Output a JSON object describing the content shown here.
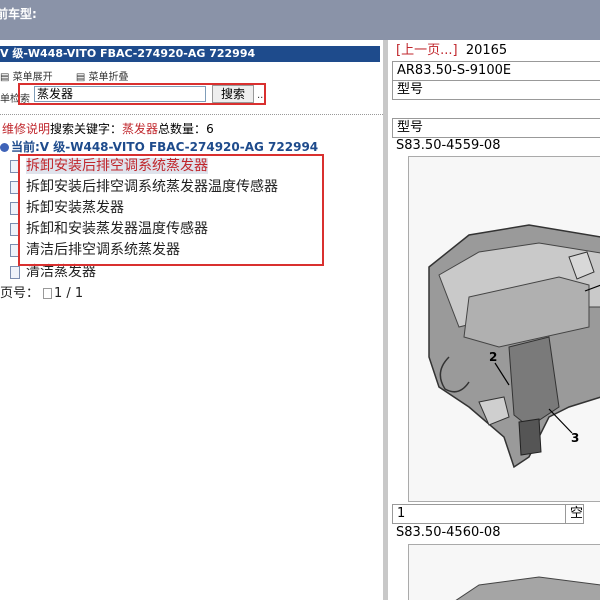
{
  "topbar": {
    "title": "前车型:"
  },
  "left": {
    "header": "V 级-W448-VITO FBAC-274920-AG 722994",
    "menu": {
      "expand": "菜单展开",
      "collapse": "菜单折叠"
    },
    "search": {
      "label": "单检索",
      "value": "蒸发器",
      "button": "搜索",
      "dots": "..."
    },
    "keyword": {
      "prefix": "维修说明",
      "mid": "搜索关键字：",
      "term": "蒸发器",
      "count_label": "总数量：",
      "count": "6"
    },
    "current": "当前:V 级-W448-VITO FBAC-274920-AG 722994",
    "items": [
      "拆卸安装后排空调系统蒸发器",
      "拆卸安装后排空调系统蒸发器温度传感器",
      "拆卸安装蒸发器",
      "拆卸和安装蒸发器温度传感器",
      "清洁后排空调系统蒸发器",
      "清洁蒸发器"
    ],
    "pager": {
      "label": "页号：",
      "value": "1 / 1"
    }
  },
  "right": {
    "prev": "[上一页...]",
    "prev_num": "20165",
    "code": "AR83.50-S-9100E",
    "model1": "型号",
    "model2": "型号",
    "figure1": "S83.50-4559-08",
    "callouts": [
      "2",
      "3"
    ],
    "row_num": "1",
    "row_text": "空",
    "figure2": "S83.50-4560-08"
  }
}
